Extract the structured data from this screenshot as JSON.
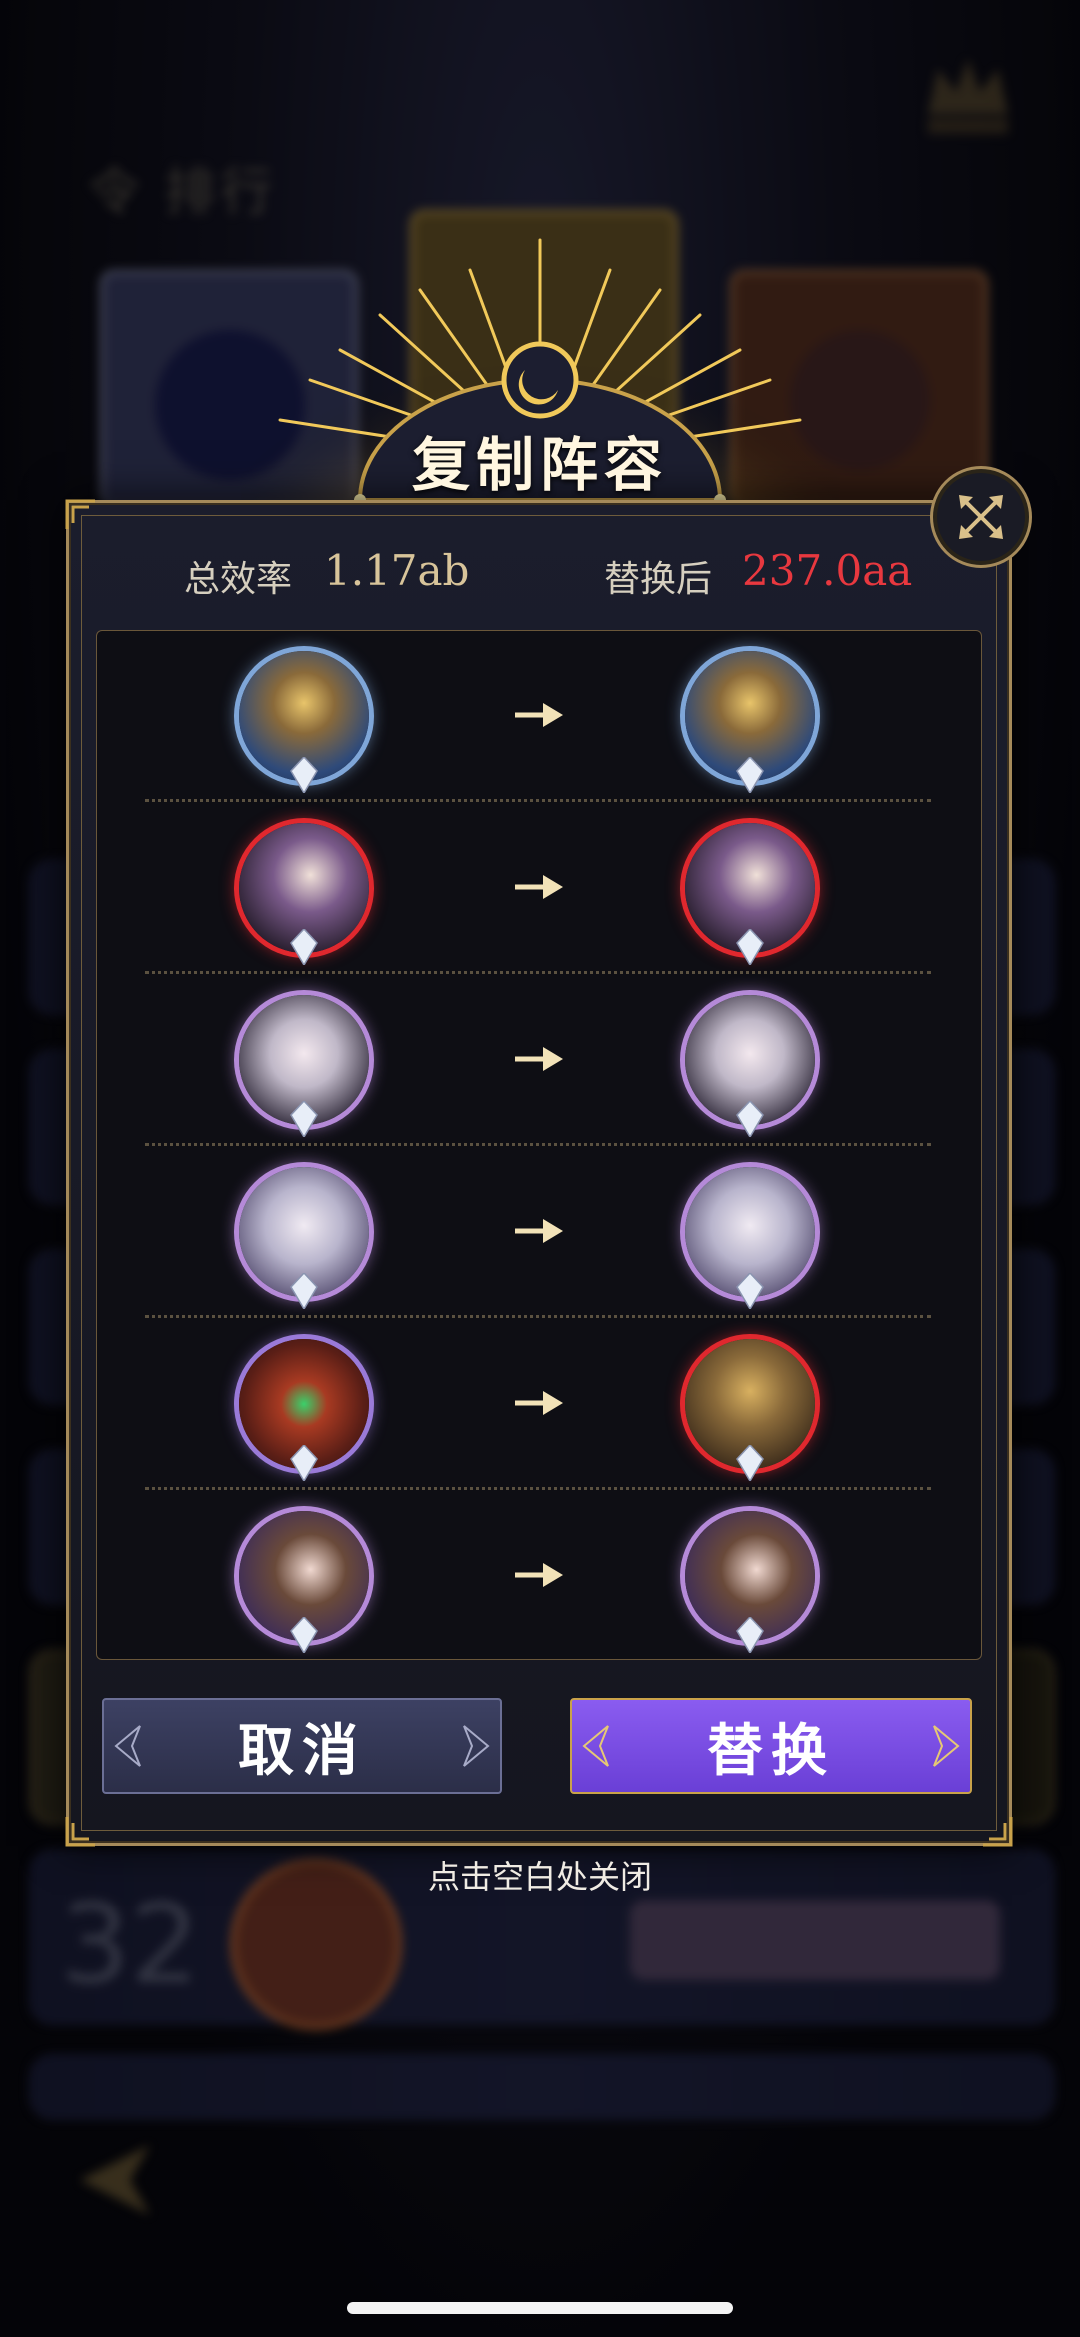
{
  "dialog": {
    "title": "复制阵容",
    "stats": {
      "total_label": "总效率",
      "total_value": "1.17ab",
      "after_label": "替换后",
      "after_value": "237.0aa"
    },
    "rows": [
      {
        "from": "hero-golden-crown-warrior",
        "to": "hero-golden-crown-warrior"
      },
      {
        "from": "hero-dark-haired-maiden",
        "to": "hero-dark-haired-maiden"
      },
      {
        "from": "hero-white-haired-witch",
        "to": "hero-white-haired-witch"
      },
      {
        "from": "hero-silver-haired-lady",
        "to": "hero-silver-haired-lady"
      },
      {
        "from": "hero-demon-mask",
        "to": "hero-golden-helmet-knight"
      },
      {
        "from": "hero-dark-haired-prince",
        "to": "hero-dark-haired-prince"
      }
    ],
    "cancel_label": "取消",
    "replace_label": "替换",
    "close_hint": "点击空白处关闭"
  },
  "colors": {
    "accent_gold": "#c9a24a",
    "after_value": "#e8383f",
    "replace_button": "#7a4ee6",
    "cancel_button": "#343858"
  }
}
